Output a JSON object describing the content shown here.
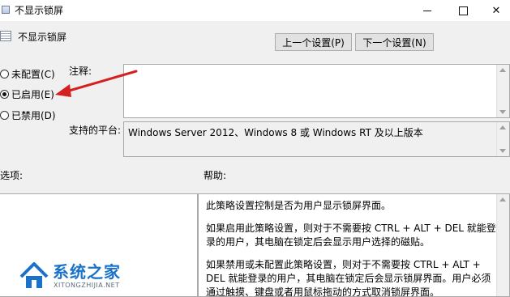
{
  "window": {
    "title": "不显示锁屏",
    "controls": {
      "minimize": "minimize-icon",
      "maximize": "maximize-icon",
      "close": "✕"
    }
  },
  "header": {
    "title": "不显示锁屏",
    "prev_button": "上一个设置(P)",
    "next_button": "下一个设置(N)"
  },
  "state": {
    "options": [
      {
        "label": "未配置(C)",
        "selected": false
      },
      {
        "label": "已启用(E)",
        "selected": true
      },
      {
        "label": "已禁用(D)",
        "selected": false
      }
    ]
  },
  "comment": {
    "label": "注释:",
    "value": ""
  },
  "platform": {
    "label": "支持的平台:",
    "value": "Windows Server 2012、Windows 8 或 Windows RT 及以上版本"
  },
  "options_panel": {
    "label": "选项:"
  },
  "help_panel": {
    "label": "帮助:",
    "paragraphs": [
      "此策略设置控制是否为用户显示锁屏界面。",
      "如果启用此策略设置，则对于不需要按 CTRL + ALT + DEL 就能登录的用户，其电脑在锁定后会显示用户选择的磁贴。",
      "如果禁用或未配置此策略设置，则对于不需要按 CTRL + ALT + DEL 就能登录的用户，其电脑在锁定后会显示锁屏界面。用户必须通过触摸、键盘或者用鼠标拖动的方式取消锁屏界面。"
    ]
  },
  "watermark": {
    "name": "系统之家",
    "url": "XITONGZHIJIA.NET"
  },
  "colors": {
    "annotation_arrow": "#d42020",
    "watermark_blue": "#1a73c8"
  }
}
